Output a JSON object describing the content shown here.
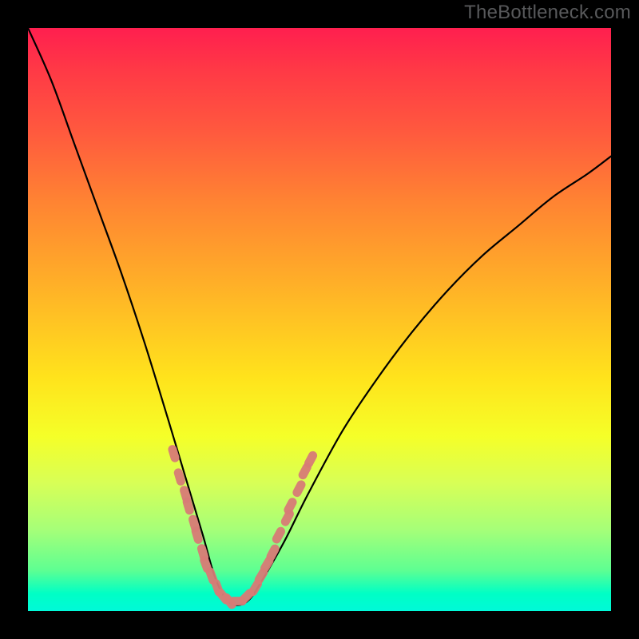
{
  "watermark": "TheBottleneck.com",
  "colors": {
    "frame": "#000000",
    "curve": "#000000",
    "marker_fill": "#d77b76",
    "marker_stroke": "#d77b76",
    "gradient_top": "#ff1f4f",
    "gradient_bottom": "#00f9d8"
  },
  "chart_data": {
    "type": "line",
    "title": "",
    "xlabel": "",
    "ylabel": "",
    "xlim": [
      0,
      100
    ],
    "ylim": [
      0,
      100
    ],
    "note": "Axes have no visible tick labels; values are normalized 0–100. y is read with 0 at the bottom (green) and 100 at the top (red). Curve is a V-shaped valley reaching ~0 near x≈33–37.",
    "series": [
      {
        "name": "bottleneck-curve",
        "x": [
          0,
          4,
          8,
          12,
          16,
          20,
          24,
          27,
          30,
          32,
          34,
          36,
          38,
          40,
          44,
          48,
          54,
          60,
          66,
          72,
          78,
          84,
          90,
          96,
          100
        ],
        "y": [
          100,
          91,
          80,
          69,
          58,
          46,
          33,
          23,
          13,
          6,
          2,
          1,
          2,
          5,
          12,
          20,
          31,
          40,
          48,
          55,
          61,
          66,
          71,
          75,
          78
        ]
      }
    ],
    "markers": {
      "name": "highlighted-points",
      "note": "Elongated pink capsule markers clustered on both flanks of the valley, roughly y between 3 and 25.",
      "points": [
        {
          "x": 25.0,
          "y": 27
        },
        {
          "x": 26.0,
          "y": 23
        },
        {
          "x": 27.0,
          "y": 20
        },
        {
          "x": 27.5,
          "y": 18
        },
        {
          "x": 28.5,
          "y": 15
        },
        {
          "x": 29.0,
          "y": 13
        },
        {
          "x": 30.0,
          "y": 10
        },
        {
          "x": 30.5,
          "y": 8
        },
        {
          "x": 31.5,
          "y": 6
        },
        {
          "x": 32.5,
          "y": 4
        },
        {
          "x": 33.5,
          "y": 2.5
        },
        {
          "x": 34.5,
          "y": 1.7
        },
        {
          "x": 36.0,
          "y": 1.7
        },
        {
          "x": 37.5,
          "y": 2.5
        },
        {
          "x": 39.0,
          "y": 4
        },
        {
          "x": 40.0,
          "y": 6
        },
        {
          "x": 41.0,
          "y": 8
        },
        {
          "x": 42.0,
          "y": 10
        },
        {
          "x": 43.0,
          "y": 13
        },
        {
          "x": 44.5,
          "y": 16
        },
        {
          "x": 45.0,
          "y": 18
        },
        {
          "x": 46.5,
          "y": 21
        },
        {
          "x": 47.5,
          "y": 24
        },
        {
          "x": 48.5,
          "y": 26
        }
      ]
    }
  }
}
